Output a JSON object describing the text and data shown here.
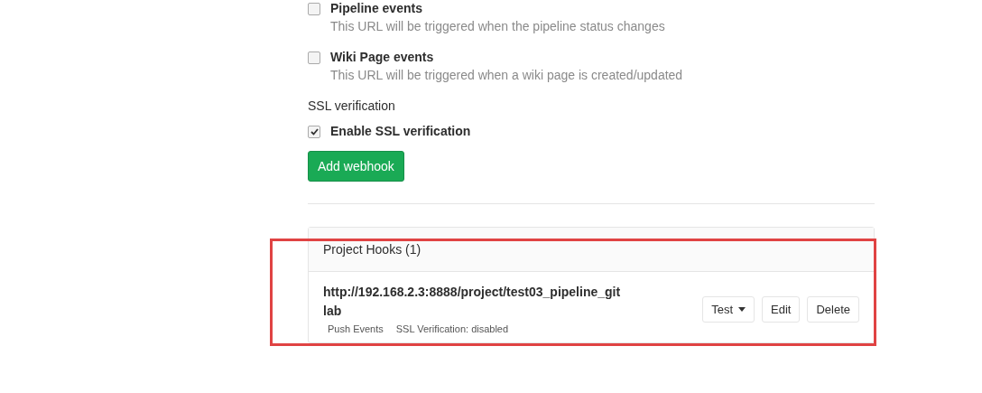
{
  "triggers": [
    {
      "label": "Pipeline events",
      "description": "This URL will be triggered when the pipeline status changes",
      "checked": false
    },
    {
      "label": "Wiki Page events",
      "description": "This URL will be triggered when a wiki page is created/updated",
      "checked": false
    }
  ],
  "ssl": {
    "heading": "SSL verification",
    "label": "Enable SSL verification",
    "checked": true
  },
  "submit_button": "Add webhook",
  "hooks_panel": {
    "title": "Project Hooks (1)",
    "hooks": [
      {
        "url": "http://192.168.2.3:8888/project/test03_pipeline_gitlab",
        "tags": [
          "Push Events",
          "SSL Verification: disabled"
        ],
        "test_button": "Test",
        "edit_button": "Edit",
        "delete_button": "Delete"
      }
    ]
  }
}
